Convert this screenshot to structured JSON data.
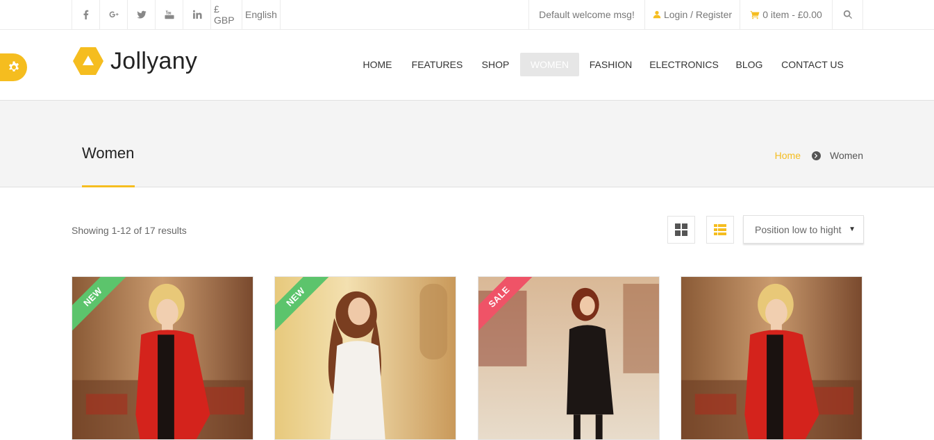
{
  "topbar": {
    "social": [
      {
        "icon": "facebook-icon"
      },
      {
        "icon": "google-plus-icon"
      },
      {
        "icon": "twitter-icon"
      },
      {
        "icon": "youtube-icon"
      },
      {
        "icon": "linkedin-icon"
      }
    ],
    "currency": "£ GBP",
    "language": "English",
    "welcome": "Default welcome msg!",
    "login": "Login / Register",
    "cart": "0 item - £0.00",
    "search_icon": "search-icon"
  },
  "header": {
    "logo_text": "Jollyany",
    "nav": [
      {
        "label": "HOME",
        "active": false
      },
      {
        "label": "FEATURES",
        "active": false
      },
      {
        "label": "SHOP",
        "active": false
      },
      {
        "label": "WOMEN",
        "active": true
      },
      {
        "label": "FASHION",
        "active": false
      },
      {
        "label": "ELECTRONICS",
        "active": false
      },
      {
        "label": "BLOG",
        "active": false
      },
      {
        "label": "CONTACT US",
        "active": false
      }
    ]
  },
  "page": {
    "title": "Women",
    "breadcrumb": {
      "home": "Home",
      "current": "Women"
    }
  },
  "shop": {
    "result_count": "Showing 1-12 of 17 results",
    "sort_selected": "Position low to hight",
    "products": [
      {
        "badge": "NEW",
        "badge_color": "#5cc46c",
        "image": "woman-red-jacket"
      },
      {
        "badge": "NEW",
        "badge_color": "#5cc46c",
        "image": "woman-white-dress"
      },
      {
        "badge": "SALE",
        "badge_color": "#ef5367",
        "image": "woman-black-dress"
      },
      {
        "badge": "",
        "badge_color": "",
        "image": "woman-red-jacket"
      }
    ]
  },
  "colors": {
    "accent": "#f5bd1f",
    "nav_active_bg": "#e6e6e6"
  }
}
